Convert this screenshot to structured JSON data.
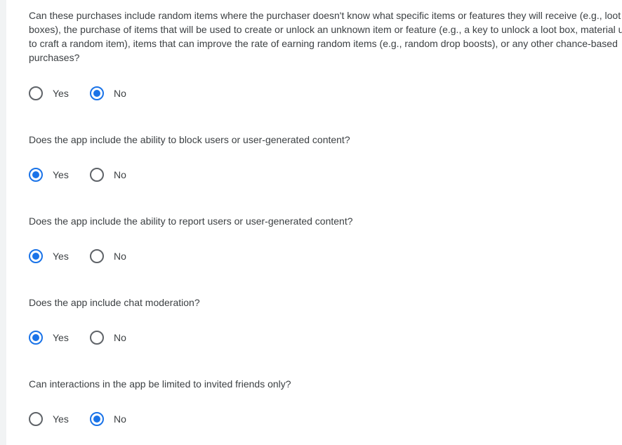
{
  "questions": [
    {
      "text": "Can these purchases include random items where the purchaser doesn't know what specific items or features they will receive (e.g., loot boxes), the purchase of items that will be used to create or unlock an unknown item or feature (e.g., a key to unlock a loot box, material used to craft a random item), items that can improve the rate of earning random items (e.g., random drop boosts), or any other chance-based purchases?",
      "yes_label": "Yes",
      "no_label": "No",
      "selected": "No"
    },
    {
      "text": "Does the app include the ability to block users or user-generated content?",
      "yes_label": "Yes",
      "no_label": "No",
      "selected": "Yes"
    },
    {
      "text": "Does the app include the ability to report users or user-generated content?",
      "yes_label": "Yes",
      "no_label": "No",
      "selected": "Yes"
    },
    {
      "text": "Does the app include chat moderation?",
      "yes_label": "Yes",
      "no_label": "No",
      "selected": "Yes"
    },
    {
      "text": "Can interactions in the app be limited to invited friends only?",
      "yes_label": "Yes",
      "no_label": "No",
      "selected": "No"
    }
  ],
  "colors": {
    "accent": "#1a73e8",
    "text": "#3c4043",
    "radio_border": "#5f6368"
  }
}
